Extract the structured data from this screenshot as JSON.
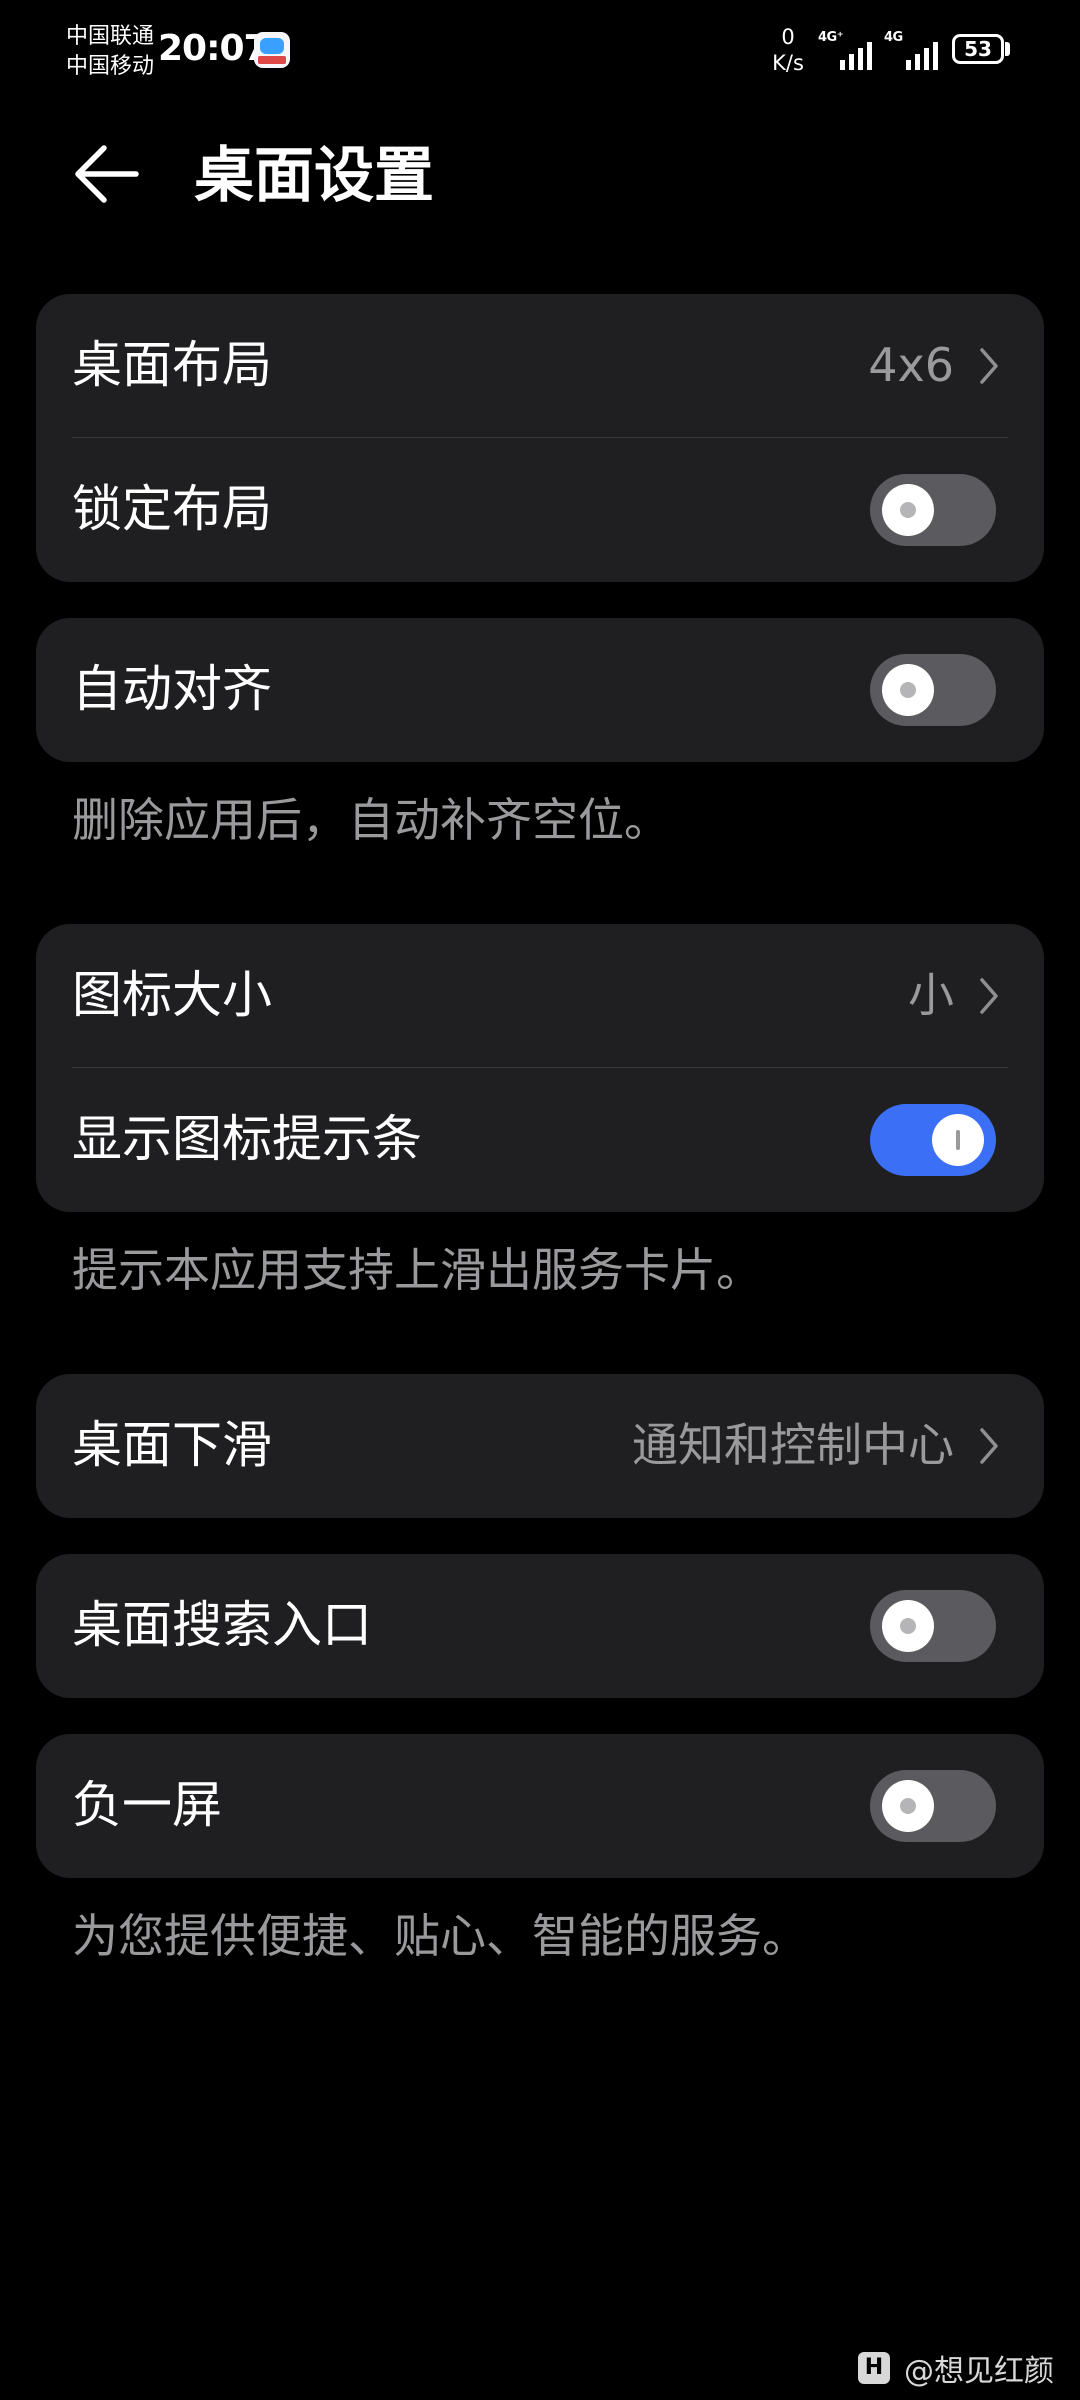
{
  "status_bar": {
    "carrier_1": "中国联通",
    "carrier_2": "中国移动",
    "time": "20:07",
    "net_speed_value": "0",
    "net_speed_unit": "K/s",
    "signal_1_label": "4G⁺",
    "signal_2_label": "4G",
    "battery_level": "53",
    "battery_fraction": 0.53
  },
  "header": {
    "title": "桌面设置",
    "back_icon": "arrow-left-icon"
  },
  "settings": {
    "desktop_layout": {
      "label": "桌面布局",
      "value": "4x6"
    },
    "lock_layout": {
      "label": "锁定布局",
      "enabled": false
    },
    "auto_align": {
      "label": "自动对齐",
      "enabled": false,
      "hint": "删除应用后，自动补齐空位。"
    },
    "icon_size": {
      "label": "图标大小",
      "value": "小"
    },
    "show_icon_hint_bar": {
      "label": "显示图标提示条",
      "enabled": true,
      "hint": "提示本应用支持上滑出服务卡片。"
    },
    "desktop_swipe_down": {
      "label": "桌面下滑",
      "value": "通知和控制中心"
    },
    "desktop_search_entry": {
      "label": "桌面搜索入口",
      "enabled": false
    },
    "minus_one_screen": {
      "label": "负一屏",
      "enabled": false,
      "hint": "为您提供便捷、贴心、智能的服务。"
    }
  },
  "colors": {
    "background": "#000000",
    "card": "#1f1f21",
    "toggle_on": "#3b70f6",
    "toggle_off": "#5b5b5f",
    "secondary_text": "#9a9a9d"
  },
  "watermark": {
    "logo": "H",
    "text": "@想见红颜"
  }
}
